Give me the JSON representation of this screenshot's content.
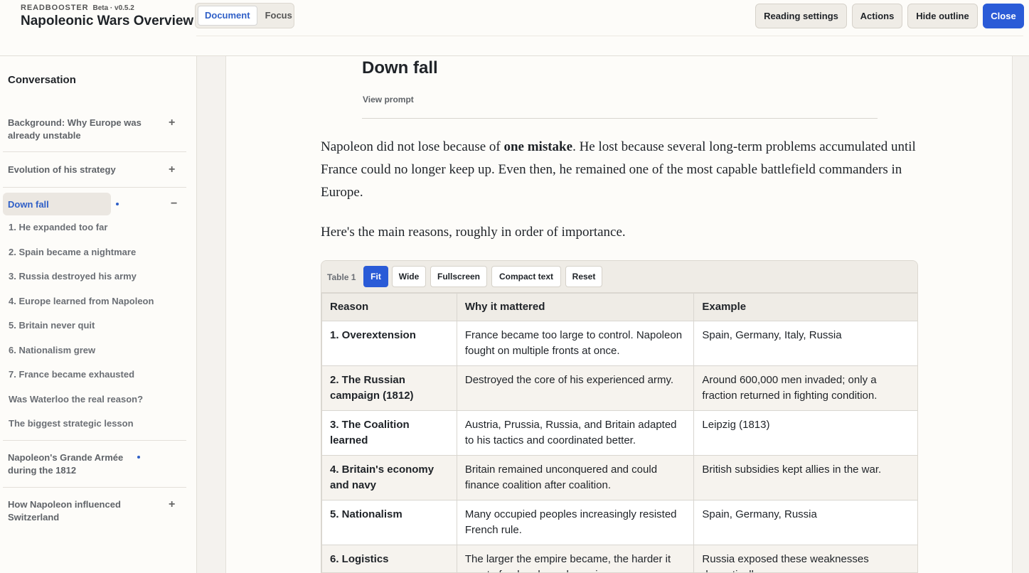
{
  "header": {
    "brand": "READBOOSTER",
    "version": "Beta · v0.5.2",
    "title": "Napoleonic Wars Overview",
    "modes": [
      "Document",
      "Focus"
    ],
    "active_mode": "Document",
    "buttons": {
      "reading_settings": "Reading settings",
      "actions": "Actions",
      "hide_outline": "Hide outline",
      "close": "Close"
    }
  },
  "sidebar": {
    "title": "Conversation",
    "sections": {
      "background": "Background: Why Europe was already unstable",
      "evolution": "Evolution of his strategy",
      "downfall": "Down fall",
      "grande_armee": "Napoleon's Grande Armée during the 1812",
      "switzerland": "How Napoleon influenced Switzerland"
    },
    "toggles": {
      "plus": "+",
      "minus": "−"
    },
    "subitems": [
      "1. He expanded too far",
      "2. Spain became a nightmare",
      "3. Russia destroyed his army",
      "4. Europe learned from Napoleon",
      "5. Britain never quit",
      "6. Nationalism grew",
      "7. France became exhausted",
      "Was Waterloo the real reason?",
      "The biggest strategic lesson"
    ]
  },
  "doc": {
    "title": "Down fall",
    "view_prompt": "View prompt",
    "p1_a": "Napoleon did not lose because of ",
    "p1_b": "one mistake",
    "p1_c": ". He lost because several long-term problems accumulated until France could no longer keep up. Even then, he remained one of the most capable battlefield commanders in Europe.",
    "p2": "Here's the main reasons, roughly in order of importance."
  },
  "table": {
    "label": "Table 1",
    "controls": [
      "Fit",
      "Wide",
      "Fullscreen",
      "Compact text",
      "Reset"
    ],
    "active_control": "Fit",
    "headers": [
      "Reason",
      "Why it mattered",
      "Example"
    ],
    "rows": [
      [
        "1. Overextension",
        "France became too large to control. Napoleon fought on multiple fronts at once.",
        "Spain, Germany, Italy, Russia"
      ],
      [
        "2. The Russian campaign (1812)",
        "Destroyed the core of his experienced army.",
        "Around 600,000 men invaded; only a fraction returned in fighting condition."
      ],
      [
        "3. The Coalition learned",
        "Austria, Prussia, Russia, and Britain adapted to his tactics and coordinated better.",
        "Leipzig (1813)"
      ],
      [
        "4. Britain's economy and navy",
        "Britain remained unconquered and could finance coalition after coalition.",
        "British subsidies kept allies in the war."
      ],
      [
        "5. Nationalism",
        "Many occupied peoples increasingly resisted French rule.",
        "Spain, Germany, Russia"
      ],
      [
        "6. Logistics",
        "The larger the empire became, the harder it was to feed and supply armies.",
        "Russia exposed these weaknesses dramatically."
      ]
    ]
  },
  "colors": {
    "accent": "#2a5bd7",
    "link": "#2f5fc7",
    "background": "#fdfcf9"
  }
}
